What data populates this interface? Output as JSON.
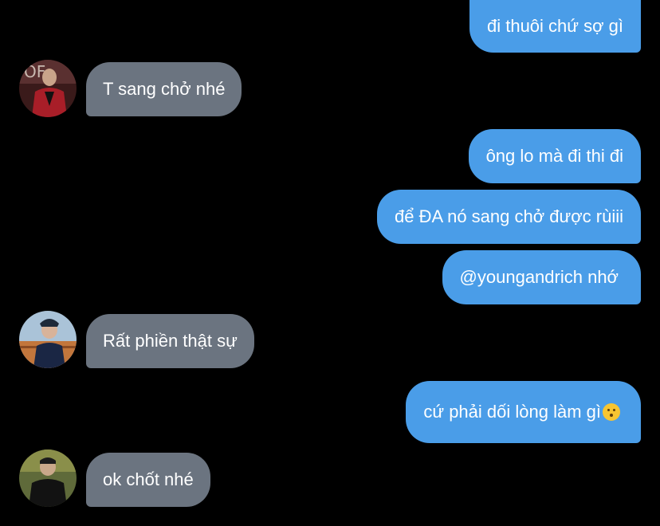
{
  "messages": [
    {
      "id": "m1",
      "direction": "sent",
      "text": "đi thuôi chứ sợ gì"
    },
    {
      "id": "m2",
      "direction": "received",
      "text": "T sang chở nhé"
    },
    {
      "id": "m3",
      "direction": "sent",
      "text": "ông lo mà đi thi đi"
    },
    {
      "id": "m4",
      "direction": "sent",
      "text": "để ĐA nó sang chở được rùiii"
    },
    {
      "id": "m5",
      "direction": "sent",
      "text": "@youngandrich nhớ"
    },
    {
      "id": "m6",
      "direction": "received",
      "text": "Rất phiền thật sự"
    },
    {
      "id": "m7",
      "direction": "sent",
      "text": "cứ phải dối lòng làm gì",
      "emoji": "kissing-face-emoji"
    },
    {
      "id": "m8",
      "direction": "received",
      "text": "ok chốt nhé"
    }
  ],
  "colors": {
    "background": "#000000",
    "sent_bubble": "#4a9de8",
    "received_bubble": "#6b7480",
    "text": "#ffffff"
  }
}
